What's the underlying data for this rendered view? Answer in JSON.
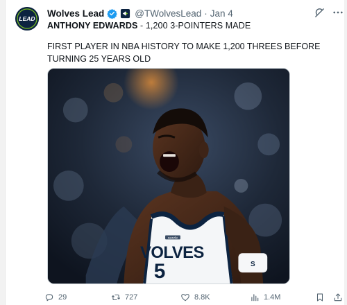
{
  "account": {
    "name": "Wolves Lead",
    "handle": "@TWolvesLead",
    "separator": "·",
    "date": "Jan 4",
    "avatar_text": "LEAD"
  },
  "tweet": {
    "headline_bold": "ANTHONY EDWARDS",
    "headline_rest": " - 1,200 3-POINTERS MADE",
    "body": "FIRST PLAYER IN NBA HISTORY TO MAKE 1,200 THREES BEFORE TURNING 25 YEARS OLD"
  },
  "media": {
    "jersey_text": "VOLVES",
    "jersey_number": "5",
    "sponsor": "sezzle",
    "wristband_text": "S"
  },
  "actions": {
    "replies": "29",
    "reposts": "727",
    "likes": "8.8K",
    "views": "1.4M"
  },
  "icons": {
    "verified": "verified-badge-icon",
    "affiliation": "affiliation-badge-icon",
    "grok": "grok-icon",
    "more": "more-icon",
    "reply": "reply-icon",
    "repost": "repost-icon",
    "like": "heart-icon",
    "views": "views-icon",
    "bookmark": "bookmark-icon",
    "share": "share-icon"
  },
  "colors": {
    "accent": "#1d9bf0",
    "text": "#0f1419",
    "muted": "#536471",
    "jersey_navy": "#0c2340",
    "jersey_white": "#f4f6f8"
  }
}
